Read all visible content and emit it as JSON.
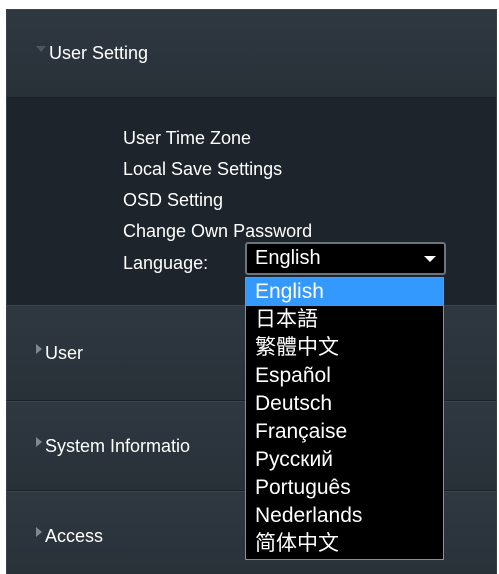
{
  "sections": {
    "user_setting": {
      "label": "User Setting",
      "expanded": true,
      "links": [
        "User Time Zone",
        "Local Save Settings",
        "OSD Setting",
        "Change Own Password"
      ],
      "language_label": "Language:",
      "language_selected": "English"
    },
    "user": {
      "label": "User"
    },
    "system_information": {
      "label": "System Informatio"
    },
    "access": {
      "label": "Access"
    }
  },
  "language_options": [
    "English",
    "日本語",
    "繁體中文",
    "Español",
    "Deutsch",
    "Française",
    "Русский",
    "Português",
    "Nederlands",
    "简体中文"
  ],
  "icons": {
    "expanded": "triangle-down-icon",
    "collapsed": "triangle-right-icon",
    "dropdown": "caret-down-icon"
  },
  "colors": {
    "panel_bg": "#232b33",
    "highlight": "#3399ff",
    "text": "#ffffff"
  }
}
